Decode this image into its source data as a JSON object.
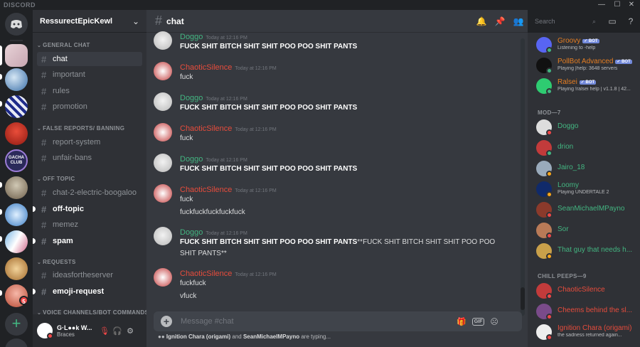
{
  "app": {
    "brand": "DISCORD"
  },
  "window_controls": {
    "minimize": "—",
    "maximize": "☐",
    "close": "✕"
  },
  "guild": {
    "name": "RessurectEpicKewl"
  },
  "categories": [
    {
      "name": "GENERAL CHAT"
    },
    {
      "name": "FALSE REPORTS/ BANNING"
    },
    {
      "name": "OFF TOPIC"
    },
    {
      "name": "REQUESTS"
    },
    {
      "name": "VOICE CHANNELS/BOT COMMANDS"
    }
  ],
  "channels": [
    {
      "name": "chat"
    },
    {
      "name": "important"
    },
    {
      "name": "rules"
    },
    {
      "name": "promotion"
    },
    {
      "name": "report-system"
    },
    {
      "name": "unfair-bans"
    },
    {
      "name": "chat-2-electric-boogaloo"
    },
    {
      "name": "off-topic"
    },
    {
      "name": "memez"
    },
    {
      "name": "spam"
    },
    {
      "name": "ideasfortheserver"
    },
    {
      "name": "emoji-request"
    }
  ],
  "servers": {
    "unread_badge": "5",
    "gacha_label": "GACHA CLUB"
  },
  "user": {
    "name": "G·L●●k W...",
    "tag": "Braces"
  },
  "header": {
    "channel": "chat",
    "search_placeholder": "Search"
  },
  "messages": [
    {
      "author": "Doggo",
      "time": "Today at 12:16 PM",
      "lines": [
        "FUCK SHIT BITCH SHIT SHIT POO POO SHIT PANTS"
      ]
    },
    {
      "author": "ChaoticSilence",
      "time": "Today at 12:16 PM",
      "lines": [
        "fuck"
      ]
    },
    {
      "author": "Doggo",
      "time": "Today at 12:16 PM",
      "lines": [
        "FUCK SHIT BITCH SHIT SHIT POO POO SHIT PANTS"
      ]
    },
    {
      "author": "ChaoticSilence",
      "time": "Today at 12:16 PM",
      "lines": [
        "fuck"
      ]
    },
    {
      "author": "Doggo",
      "time": "Today at 12:16 PM",
      "lines": [
        "FUCK SHIT BITCH SHIT SHIT POO POO SHIT PANTS"
      ]
    },
    {
      "author": "ChaoticSilence",
      "time": "Today at 12:16 PM",
      "lines": [
        "fuck",
        "fuckfuckfuckfuckfuck"
      ]
    },
    {
      "author": "Doggo",
      "time": "Today at 12:16 PM",
      "lines": [
        "FUCK SHIT BITCH SHIT SHIT POO POO SHIT PANTS",
        "**FUCK SHIT BITCH SHIT SHIT POO POO",
        "SHIT PANTS**"
      ]
    },
    {
      "author": "ChaoticSilence",
      "time": "Today at 12:16 PM",
      "lines": [
        "fuckfuck",
        "vfuck"
      ]
    }
  ],
  "composer": {
    "placeholder": "Message #chat",
    "gif_label": "GIF"
  },
  "typing": {
    "names": "Ignition Chara (origami)",
    "and": "and",
    "names2": "SeanMichaelMPayno",
    "suffix": "are typing..."
  },
  "members": {
    "bots": [
      {
        "name": "Groovy",
        "bot": "✓ BOT",
        "activity": "Listening to -help",
        "color": "#e67e22"
      },
      {
        "name": "PollBot Advanced",
        "bot": "✓ BOT",
        "activity": "Playing |help: 3648 servers",
        "color": "#e67e22"
      },
      {
        "name": "Ralsei",
        "bot": "✓ BOT",
        "activity": "Playing !ralsei help | v1.1.8 | 42...",
        "color": "#e67e22"
      }
    ],
    "mod_header": "MOD—7",
    "mods": [
      {
        "name": "Doggo",
        "activity": "",
        "color": "#43b581"
      },
      {
        "name": "drion",
        "activity": "",
        "color": "#43b581"
      },
      {
        "name": "Jairo_18",
        "activity": "",
        "color": "#43b581"
      },
      {
        "name": "Loomy",
        "activity": "Playing UNDERTALE 2",
        "color": "#43b581"
      },
      {
        "name": "SeanMichaelMPayno",
        "activity": "",
        "color": "#43b581"
      },
      {
        "name": "Sor",
        "activity": "",
        "color": "#43b581"
      },
      {
        "name": "That guy that needs h...",
        "activity": "",
        "color": "#43b581"
      }
    ],
    "chill_header": "CHILL PEEPS—9",
    "chill": [
      {
        "name": "ChaoticSilence",
        "activity": "",
        "color": "#e74c3c"
      },
      {
        "name": "Cheems behind the sl...",
        "activity": "",
        "color": "#e74c3c"
      },
      {
        "name": "Ignition Chara (origami)",
        "activity": "the sadness returned again...",
        "color": "#e74c3c"
      }
    ]
  },
  "colors": {
    "doggo": "#43b581",
    "chaotic": "#e74c3c",
    "bot_orange": "#e67e22",
    "online": "#43b581",
    "dnd": "#f04747",
    "idle": "#faa61a"
  }
}
